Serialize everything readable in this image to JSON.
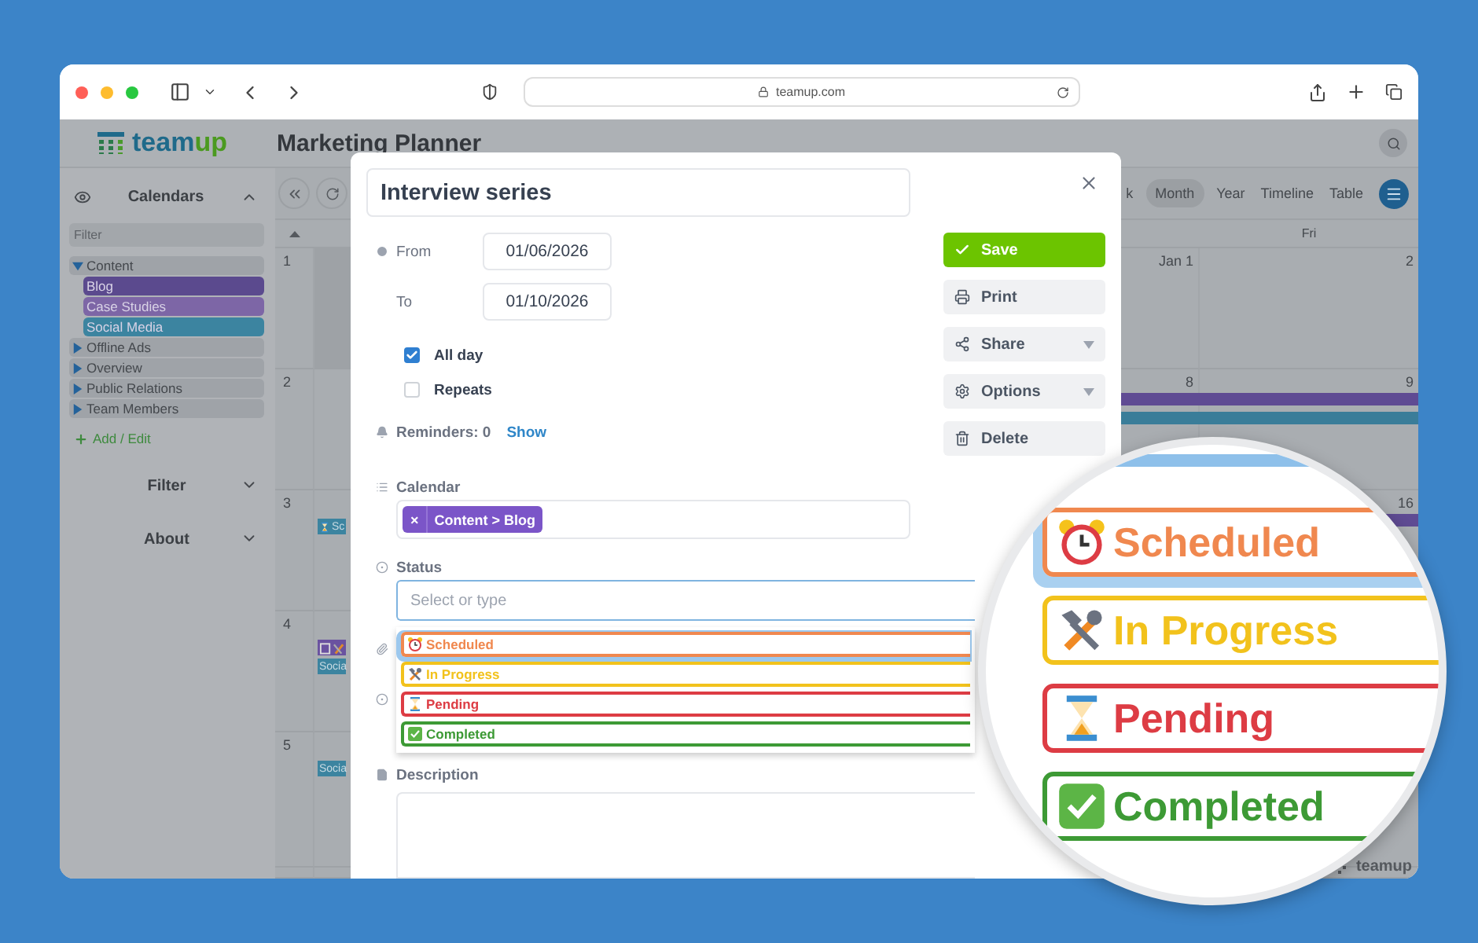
{
  "browser": {
    "url": "teamup.com"
  },
  "app": {
    "logo": "teamup",
    "title": "Marketing Planner",
    "footer_brand": "teamup"
  },
  "sidebar": {
    "header": "Calendars",
    "filter_placeholder": "Filter",
    "tree": [
      {
        "name": "Content",
        "expanded": true,
        "children": [
          {
            "name": "Blog",
            "color": "#5b4a8e"
          },
          {
            "name": "Case Studies",
            "color": "#7d66a6"
          },
          {
            "name": "Social Media",
            "color": "#3c84a0"
          }
        ]
      },
      {
        "name": "Offline Ads",
        "expanded": false
      },
      {
        "name": "Overview",
        "expanded": false
      },
      {
        "name": "Public Relations",
        "expanded": false
      },
      {
        "name": "Team Members",
        "expanded": false
      }
    ],
    "add_edit": "Add / Edit",
    "sections": [
      {
        "label": "Filter",
        "expanded": false
      },
      {
        "label": "About",
        "expanded": false
      }
    ]
  },
  "calendar": {
    "views": [
      {
        "label": "k",
        "selected": false
      },
      {
        "label": "Month",
        "selected": true
      },
      {
        "label": "Year",
        "selected": false
      },
      {
        "label": "Timeline",
        "selected": false
      },
      {
        "label": "Table",
        "selected": false
      }
    ],
    "weekday": "Fri",
    "weeks": [
      {
        "number": "1",
        "thu": "Jan 1",
        "fri": "2"
      },
      {
        "number": "2",
        "thu": "8",
        "fri": "9",
        "bars": [
          {
            "color": "#5f4b93"
          },
          {
            "color": "#3a7d99"
          }
        ]
      },
      {
        "number": "3",
        "fri": "16",
        "bars": [
          {
            "color": "#5f4b93"
          }
        ],
        "events": [
          {
            "label": "Sc",
            "color": "#3c84a0",
            "kind": "pending"
          }
        ]
      },
      {
        "number": "4",
        "events": [
          {
            "color": "#6a52a0",
            "kind": "multi"
          },
          {
            "label": "Socia",
            "color": "#3c84a0",
            "kind": "plain"
          }
        ]
      },
      {
        "number": "5",
        "events": [
          {
            "label": "Socia",
            "color": "#3c84a0",
            "kind": "plain"
          }
        ]
      }
    ]
  },
  "modal": {
    "title": "Interview series",
    "from_label": "From",
    "from": "01/06/2026",
    "to_label": "To",
    "to": "01/10/2026",
    "all_day": {
      "label": "All day",
      "checked": true
    },
    "repeats": {
      "label": "Repeats",
      "checked": false
    },
    "reminders": "Reminders: 0",
    "reminders_link": "Show",
    "calendar_label": "Calendar",
    "calendar_chip": "Content > Blog",
    "chip_remove": "×",
    "status_label": "Status",
    "status_placeholder": "Select or type",
    "statuses": [
      {
        "label": "Scheduled",
        "kind": "scheduled",
        "color": "#f0884f",
        "highlighted": true
      },
      {
        "label": "In Progress",
        "kind": "in_progress",
        "color": "#f2c21c",
        "highlighted": false
      },
      {
        "label": "Pending",
        "kind": "pending",
        "color": "#dd3c44",
        "highlighted": false
      },
      {
        "label": "Completed",
        "kind": "completed",
        "color": "#3d9a35",
        "highlighted": false
      }
    ],
    "description_label": "Description",
    "actions": [
      {
        "label": "Save",
        "kind": "save",
        "dropdown": false
      },
      {
        "label": "Print",
        "kind": "print",
        "dropdown": false
      },
      {
        "label": "Share",
        "kind": "share",
        "dropdown": true
      },
      {
        "label": "Options",
        "kind": "options",
        "dropdown": true
      },
      {
        "label": "Delete",
        "kind": "delete",
        "dropdown": false
      }
    ]
  },
  "magnifier": {
    "items": [
      {
        "label": "Scheduled",
        "kind": "scheduled",
        "color": "#f0884f",
        "highlighted": true
      },
      {
        "label": "In Progress",
        "kind": "in_progress",
        "color": "#f2c21c",
        "highlighted": false
      },
      {
        "label": "Pending",
        "kind": "pending",
        "color": "#dd3c44",
        "highlighted": false
      },
      {
        "label": "Completed",
        "kind": "completed",
        "color": "#3d9a35",
        "highlighted": false
      }
    ]
  }
}
